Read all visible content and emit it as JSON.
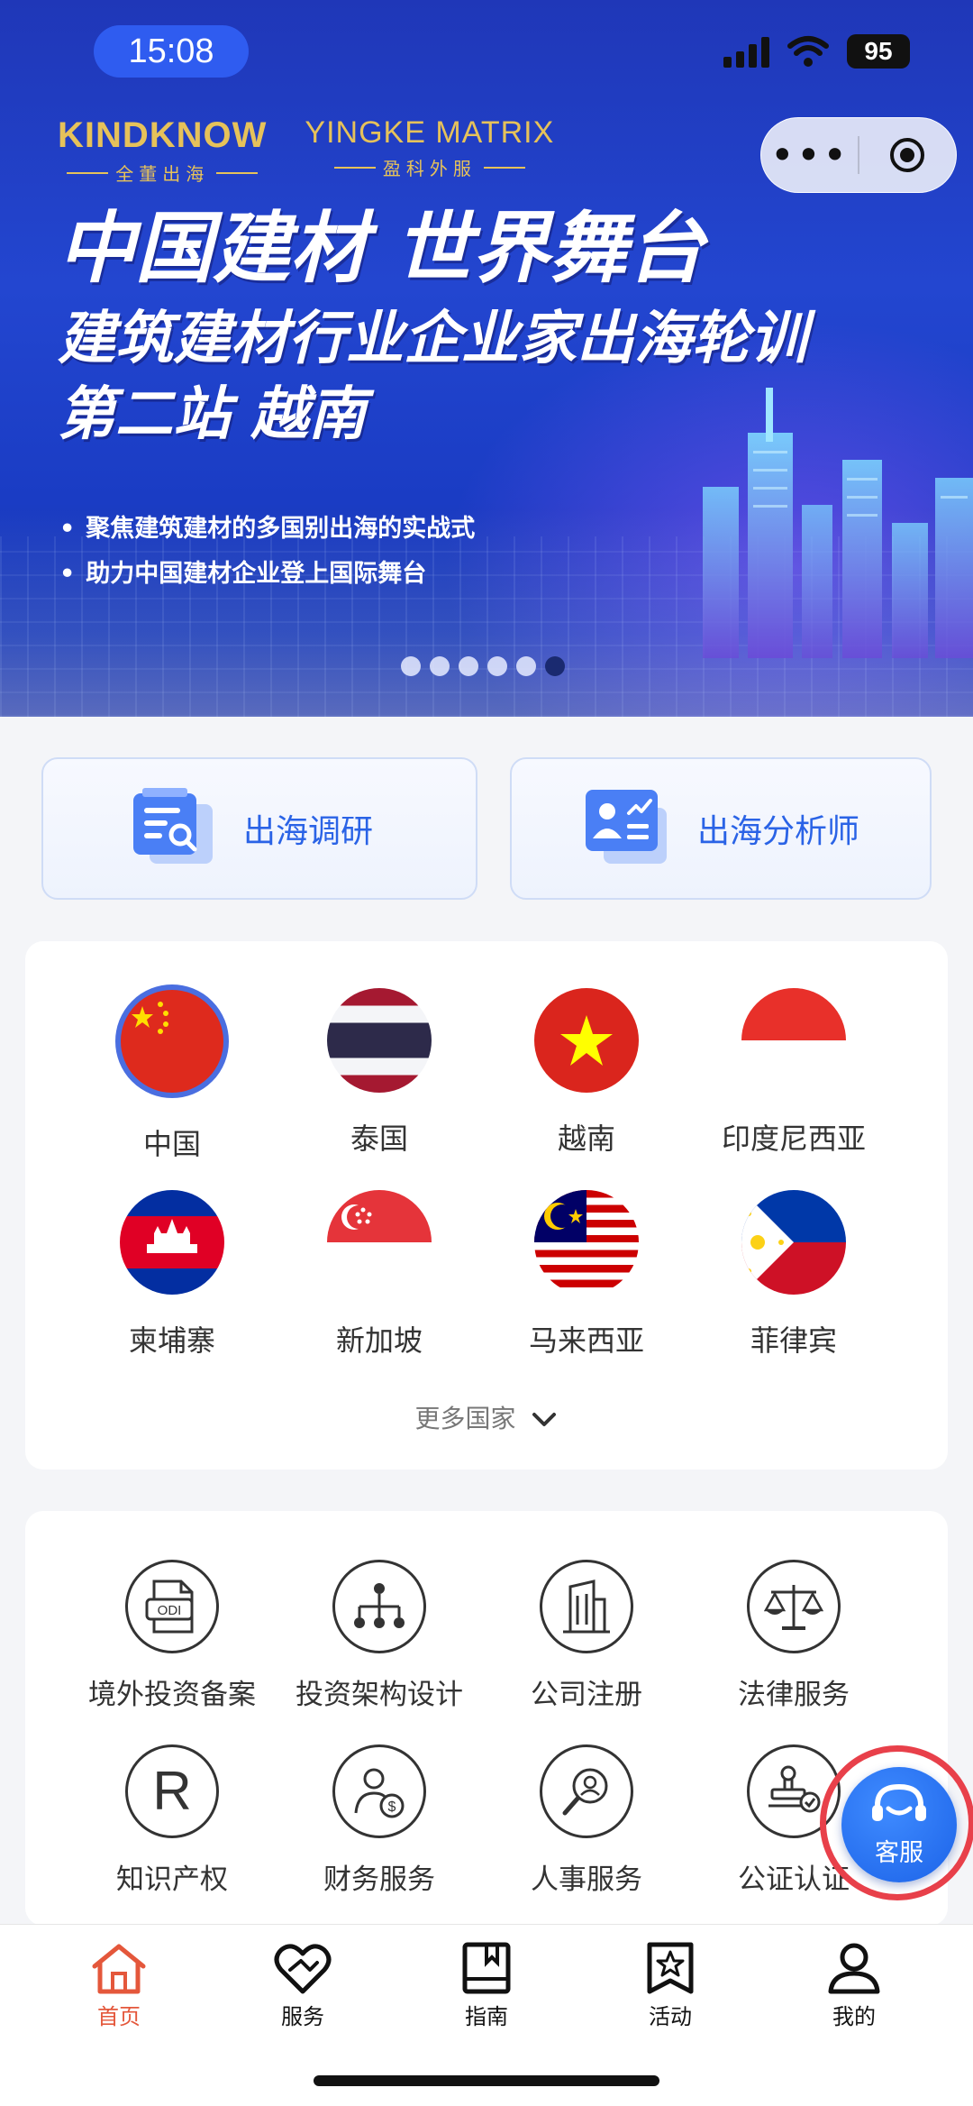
{
  "status_bar": {
    "time": "15:08",
    "battery": "95"
  },
  "mini_program": {
    "more": "•••"
  },
  "banner": {
    "logo_left_main": "KINDKNOW",
    "logo_left_sub": "全董出海",
    "logo_right_main": "YINGKE MATRIX",
    "logo_right_sub": "盈科外服",
    "headline_1": "中国建材 世界舞台",
    "headline_2": "建筑建材行业企业家出海轮训",
    "headline_3": "第二站 越南",
    "bullets": [
      "聚焦建筑建材的多国别出海的实战式",
      "助力中国建材企业登上国际舞台"
    ],
    "carousel_count": 6,
    "carousel_active": 6
  },
  "quick_tools": [
    {
      "label": "出海调研",
      "icon": "research-doc-icon"
    },
    {
      "label": "出海分析师",
      "icon": "analyst-card-icon"
    }
  ],
  "countries": {
    "items": [
      {
        "name": "中国",
        "flag": "china-flag-icon"
      },
      {
        "name": "泰国",
        "flag": "thailand-flag-icon"
      },
      {
        "name": "越南",
        "flag": "vietnam-flag-icon"
      },
      {
        "name": "印度尼西亚",
        "flag": "indonesia-flag-icon"
      },
      {
        "name": "柬埔寨",
        "flag": "cambodia-flag-icon"
      },
      {
        "name": "新加坡",
        "flag": "singapore-flag-icon"
      },
      {
        "name": "马来西亚",
        "flag": "malaysia-flag-icon"
      },
      {
        "name": "菲律宾",
        "flag": "philippines-flag-icon"
      }
    ],
    "more_label": "更多国家"
  },
  "services": {
    "items": [
      {
        "name": "境外投资备案",
        "icon": "odi-document-icon",
        "badge": "ODI"
      },
      {
        "name": "投资架构设计",
        "icon": "org-structure-icon"
      },
      {
        "name": "公司注册",
        "icon": "building-icon"
      },
      {
        "name": "法律服务",
        "icon": "scales-icon"
      },
      {
        "name": "知识产权",
        "icon": "registered-mark-icon",
        "badge": "R"
      },
      {
        "name": "财务服务",
        "icon": "finance-person-icon"
      },
      {
        "name": "人事服务",
        "icon": "hr-search-icon"
      },
      {
        "name": "公证认证",
        "icon": "stamp-icon"
      }
    ]
  },
  "customer_service": {
    "label": "客服"
  },
  "tabbar": {
    "items": [
      {
        "label": "首页",
        "icon": "home-icon"
      },
      {
        "label": "服务",
        "icon": "heart-handshake-icon"
      },
      {
        "label": "指南",
        "icon": "guide-book-icon"
      },
      {
        "label": "活动",
        "icon": "star-bookmark-icon"
      },
      {
        "label": "我的",
        "icon": "user-icon"
      }
    ],
    "active_index": 0
  },
  "colors": {
    "accent_blue": "#2a63e6",
    "active_tab": "#e4573b",
    "banner_blue": "#2346d0"
  }
}
